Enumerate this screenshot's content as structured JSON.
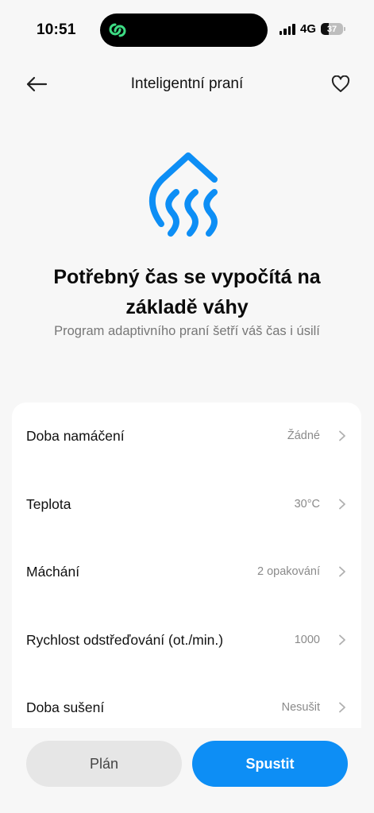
{
  "status_bar": {
    "time": "10:51",
    "network": "4G",
    "battery_level": "37",
    "island_icon": "link-loop-icon",
    "accent_green": "#3ddc84"
  },
  "header": {
    "title": "Inteligentní praní",
    "back_icon": "arrow-left-icon",
    "favorite_icon": "heart-outline-icon"
  },
  "hero": {
    "icon": "water-drop-steam-icon",
    "headline": "Potřebný čas se vypočítá na základě váhy",
    "subline": "Program adaptivního praní šetří váš čas i úsilí",
    "accent": "#0d8ef5"
  },
  "settings": [
    {
      "label": "Doba namáčení",
      "value": "Žádné"
    },
    {
      "label": "Teplota",
      "value": "30°C"
    },
    {
      "label": "Máchání",
      "value": "2 opakování"
    },
    {
      "label": "Rychlost odstřeďování (ot./min.)",
      "value": "1000"
    },
    {
      "label": "Doba sušení",
      "value": "Nesušit"
    }
  ],
  "actions": {
    "plan_label": "Plán",
    "start_label": "Spustit"
  }
}
